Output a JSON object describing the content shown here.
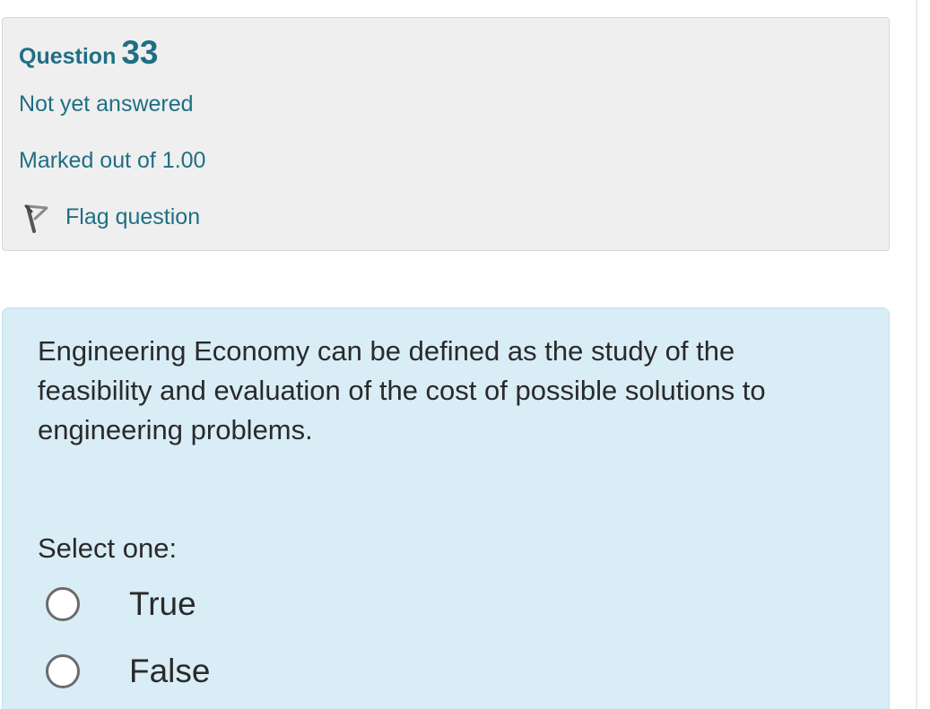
{
  "question_info": {
    "title_word": "Question",
    "number": "33",
    "state": "Not yet answered",
    "grade": "Marked out of 1.00",
    "flag_label": "Flag question",
    "flag_icon": "flag-icon"
  },
  "formulation": {
    "question_text": "Engineering Economy can be defined as the study of the feasibility and evaluation of the cost of possible solutions to engineering problems.",
    "prompt": "Select one:",
    "options": [
      {
        "label": "True",
        "selected": false
      },
      {
        "label": "False",
        "selected": false
      }
    ]
  },
  "colors": {
    "accent": "#1f6f84",
    "info_background": "#efefef",
    "formulation_background": "#d9edf7"
  }
}
